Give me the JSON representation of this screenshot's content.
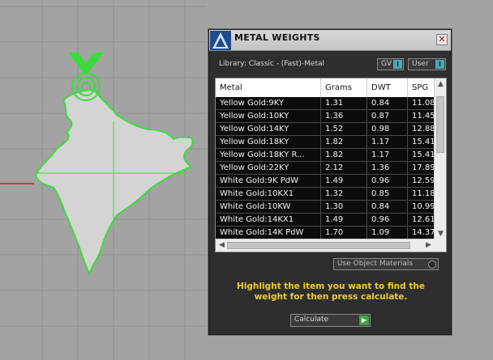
{
  "dialog": {
    "title": "METAL WEIGHTS",
    "close_label": "✕",
    "library_label": "Library: Classic - (Fast)-Metal",
    "gv_label": "GV",
    "user_label": "User",
    "columns": [
      "Metal",
      "Grams",
      "DWT",
      "SPG"
    ],
    "rows": [
      [
        "Yellow Gold:9KY",
        "1.31",
        "0.84",
        "11.08"
      ],
      [
        "Yellow Gold:10KY",
        "1.36",
        "0.87",
        "11.45"
      ],
      [
        "Yellow Gold:14KY",
        "1.52",
        "0.98",
        "12.88"
      ],
      [
        "Yellow Gold:18KY",
        "1.82",
        "1.17",
        "15.41"
      ],
      [
        "Yellow Gold:18KY R...",
        "1.82",
        "1.17",
        "15.41"
      ],
      [
        "Yellow Gold:22KY",
        "2.12",
        "1.36",
        "17.89"
      ],
      [
        "White Gold:9K PdW",
        "1.49",
        "0.96",
        "12.59"
      ],
      [
        "White Gold:10KX1",
        "1.32",
        "0.85",
        "11.18"
      ],
      [
        "White Gold:10KW",
        "1.30",
        "0.84",
        "10.99"
      ],
      [
        "White Gold:14KX1",
        "1.49",
        "0.96",
        "12.61"
      ],
      [
        "White Gold:14K PdW",
        "1.70",
        "1.09",
        "14.37"
      ]
    ],
    "use_object_materials_label": "Use Object Materials",
    "instruction": "Highlight the item you want to find the weight for then press calculate.",
    "calculate_label": "Calculate"
  },
  "colors": {
    "accent_text": "#f2cc2e",
    "selection_green": "#35e035",
    "toggle_indicator": "#48a8b8"
  },
  "icons": {
    "logo": "jewelcad-logo-icon",
    "close": "close-icon",
    "scroll_up": "arrow-up-icon",
    "scroll_down": "arrow-down-icon",
    "scroll_left": "arrow-left-icon",
    "scroll_right": "arrow-right-icon",
    "calculate_go": "play-icon"
  }
}
